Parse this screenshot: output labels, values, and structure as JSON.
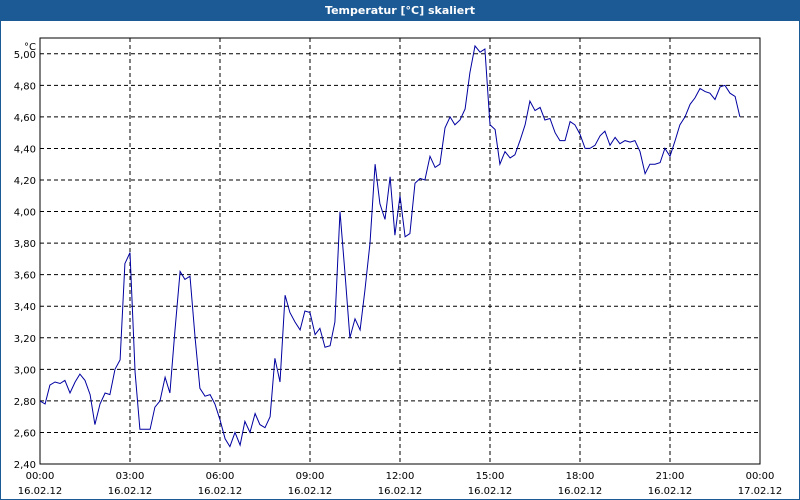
{
  "window": {
    "title": "Temperatur [°C] skaliert"
  },
  "chart_data": {
    "type": "line",
    "title": "Temperatur [°C] skaliert",
    "ylabel": "°C",
    "xlabel": "",
    "ylim": [
      2.4,
      5.1
    ],
    "xlim": [
      "16.02.12 00:00",
      "17.02.12 00:00"
    ],
    "grid": true,
    "y_ticks": [
      "2,40",
      "2,60",
      "2,80",
      "3,00",
      "3,20",
      "3,40",
      "3,60",
      "3,80",
      "4,00",
      "4,20",
      "4,40",
      "4,60",
      "4,80",
      "5,00"
    ],
    "x_ticks": [
      {
        "time": "00:00",
        "date": "16.02.12"
      },
      {
        "time": "03:00",
        "date": "16.02.12"
      },
      {
        "time": "06:00",
        "date": "16.02.12"
      },
      {
        "time": "09:00",
        "date": "16.02.12"
      },
      {
        "time": "12:00",
        "date": "16.02.12"
      },
      {
        "time": "15:00",
        "date": "16.02.12"
      },
      {
        "time": "18:00",
        "date": "16.02.12"
      },
      {
        "time": "21:00",
        "date": "16.02.12"
      },
      {
        "time": "00:00",
        "date": "17.02.12"
      }
    ],
    "series": [
      {
        "color": "#0000a0",
        "x_hours": [
          0,
          0.17,
          0.33,
          0.5,
          0.67,
          0.83,
          1,
          1.17,
          1.33,
          1.5,
          1.67,
          1.83,
          2,
          2.17,
          2.33,
          2.5,
          2.67,
          2.83,
          3,
          3.17,
          3.33,
          3.5,
          3.67,
          3.83,
          4,
          4.17,
          4.33,
          4.5,
          4.67,
          4.83,
          5,
          5.17,
          5.33,
          5.5,
          5.67,
          5.83,
          6,
          6.17,
          6.33,
          6.5,
          6.67,
          6.83,
          7,
          7.17,
          7.33,
          7.5,
          7.67,
          7.83,
          8,
          8.17,
          8.33,
          8.5,
          8.67,
          8.83,
          9,
          9.17,
          9.33,
          9.5,
          9.67,
          9.83,
          10,
          10.17,
          10.33,
          10.5,
          10.67,
          10.83,
          11,
          11.17,
          11.33,
          11.5,
          11.67,
          11.83,
          12,
          12.17,
          12.33,
          12.5,
          12.67,
          12.83,
          13,
          13.17,
          13.33,
          13.5,
          13.67,
          13.83,
          14,
          14.17,
          14.33,
          14.5,
          14.67,
          14.83,
          15,
          15.17,
          15.33,
          15.5,
          15.67,
          15.83,
          16,
          16.17,
          16.33,
          16.5,
          16.67,
          16.83,
          17,
          17.17,
          17.33,
          17.5,
          17.67,
          17.83,
          18,
          18.17,
          18.33,
          18.5,
          18.67,
          18.83,
          19,
          19.17,
          19.33,
          19.5,
          19.67,
          19.83,
          20,
          20.17,
          20.33,
          20.5,
          20.67,
          20.83,
          21,
          21.17,
          21.33,
          21.5,
          21.67,
          21.83,
          22,
          22.17,
          22.33,
          22.5,
          22.67,
          22.83,
          23,
          23.17,
          23.33,
          23.5,
          23.67,
          23.83
        ],
        "y": [
          2.8,
          2.78,
          2.9,
          2.92,
          2.91,
          2.93,
          2.85,
          2.92,
          2.97,
          2.93,
          2.84,
          2.65,
          2.78,
          2.85,
          2.84,
          3.0,
          3.06,
          3.67,
          3.74,
          2.98,
          2.62,
          2.62,
          2.62,
          2.76,
          2.8,
          2.95,
          2.85,
          3.25,
          3.62,
          3.57,
          3.59,
          3.2,
          2.88,
          2.83,
          2.84,
          2.78,
          2.68,
          2.56,
          2.51,
          2.6,
          2.52,
          2.67,
          2.6,
          2.72,
          2.65,
          2.63,
          2.7,
          3.07,
          2.92,
          3.47,
          3.36,
          3.3,
          3.25,
          3.37,
          3.36,
          3.22,
          3.26,
          3.14,
          3.15,
          3.3,
          4.0,
          3.6,
          3.2,
          3.32,
          3.25,
          3.5,
          3.8,
          4.3,
          4.05,
          3.95,
          4.22,
          3.85,
          4.1,
          3.84,
          3.86,
          4.18,
          4.21,
          4.2,
          4.35,
          4.28,
          4.3,
          4.53,
          4.6,
          4.55,
          4.58,
          4.65,
          4.88,
          5.05,
          5.01,
          5.03,
          4.55,
          4.52,
          4.3,
          4.38,
          4.34,
          4.36,
          4.45,
          4.55,
          4.7,
          4.64,
          4.66,
          4.58,
          4.59,
          4.5,
          4.45,
          4.45,
          4.57,
          4.55,
          4.49,
          4.4,
          4.4,
          4.42,
          4.48,
          4.51,
          4.42,
          4.47,
          4.43,
          4.45,
          4.44,
          4.45,
          4.38,
          4.24,
          4.3,
          4.3,
          4.31,
          4.4,
          4.35,
          4.45,
          4.55,
          4.6,
          4.68,
          4.72,
          4.78,
          4.76,
          4.75,
          4.71,
          4.79,
          4.8,
          4.75,
          4.73,
          4.6
        ]
      }
    ]
  }
}
